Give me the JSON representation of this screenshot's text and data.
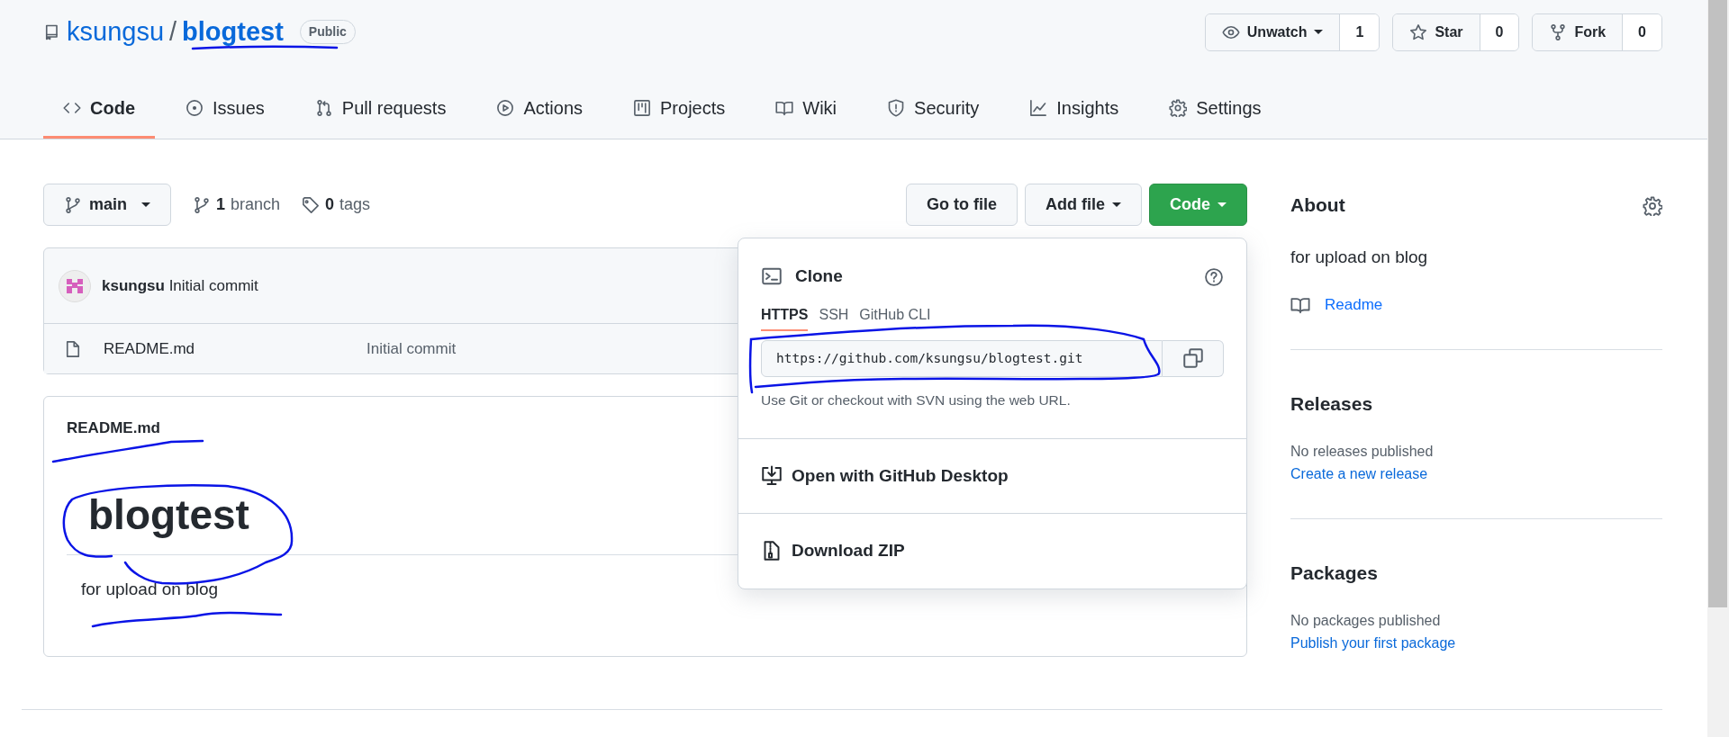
{
  "repo": {
    "owner": "ksungsu",
    "separator": "/",
    "name": "blogtest",
    "visibility": "Public"
  },
  "repo_actions": [
    {
      "label": "Unwatch",
      "count": "1",
      "has_caret": true
    },
    {
      "label": "Star",
      "count": "0",
      "has_caret": false
    },
    {
      "label": "Fork",
      "count": "0",
      "has_caret": false
    }
  ],
  "tabs": [
    {
      "label": "Code",
      "selected": true
    },
    {
      "label": "Issues",
      "selected": false
    },
    {
      "label": "Pull requests",
      "selected": false
    },
    {
      "label": "Actions",
      "selected": false
    },
    {
      "label": "Projects",
      "selected": false
    },
    {
      "label": "Wiki",
      "selected": false
    },
    {
      "label": "Security",
      "selected": false
    },
    {
      "label": "Insights",
      "selected": false
    },
    {
      "label": "Settings",
      "selected": false
    }
  ],
  "branch_button": {
    "label": "main"
  },
  "ref_counts": [
    {
      "count": "1",
      "label": "branch"
    },
    {
      "count": "0",
      "label": "tags"
    }
  ],
  "file_buttons": [
    {
      "label": "Go to file",
      "kind": "plain"
    },
    {
      "label": "Add file",
      "kind": "menu"
    },
    {
      "label": "Code",
      "kind": "primary"
    }
  ],
  "commit": {
    "author": "ksungsu",
    "message": "Initial commit"
  },
  "files": [
    {
      "name": "README.md",
      "message": "Initial commit"
    }
  ],
  "readme": {
    "filename": "README.md",
    "heading": "blogtest",
    "text": "for upload on blog"
  },
  "clone_menu": {
    "title": "Clone",
    "tabs": [
      {
        "label": "HTTPS",
        "selected": true
      },
      {
        "label": "SSH",
        "selected": false
      },
      {
        "label": "GitHub CLI",
        "selected": false
      }
    ],
    "url": "https://github.com/ksungsu/blogtest.git",
    "hint": "Use Git or checkout with SVN using the web URL.",
    "items": [
      {
        "label": "Open with GitHub Desktop"
      },
      {
        "label": "Download ZIP"
      }
    ]
  },
  "about": {
    "title": "About",
    "description": "for upload on blog",
    "readme_link": "Readme"
  },
  "releases": {
    "title": "Releases",
    "empty": "No releases published",
    "link": "Create a new release"
  },
  "packages": {
    "title": "Packages",
    "empty": "No packages published",
    "link": "Publish your first package"
  }
}
